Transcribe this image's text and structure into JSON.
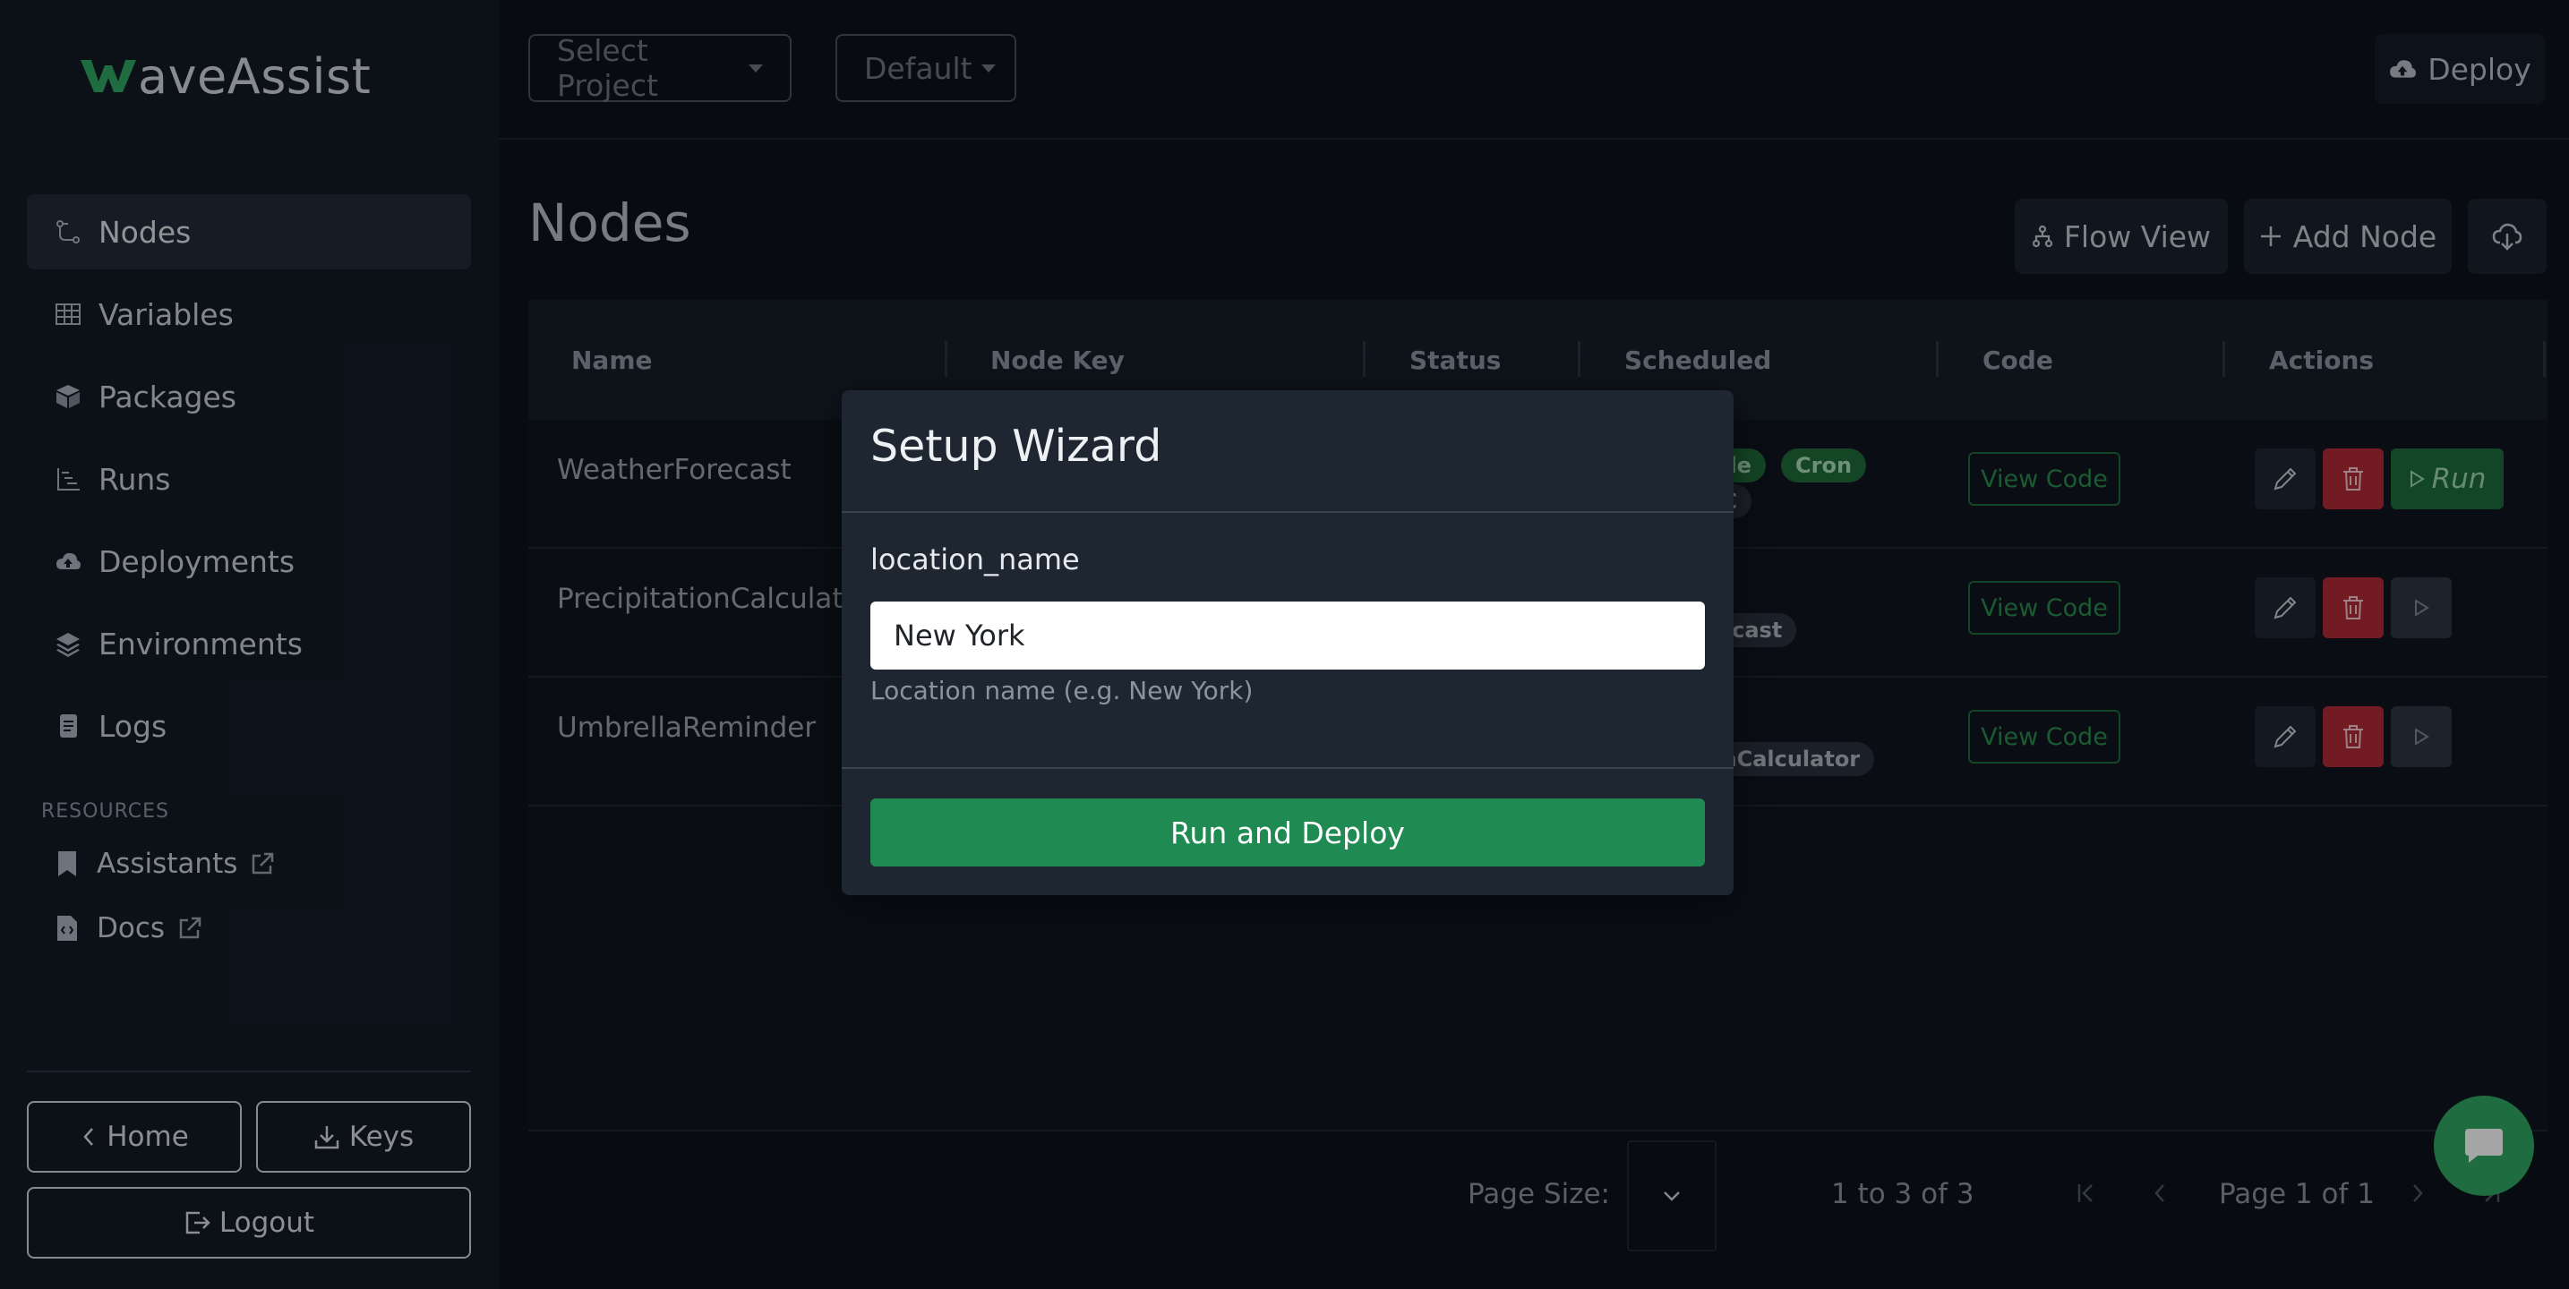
{
  "app": {
    "logo_mark": "W",
    "logo_text": "aveAssist"
  },
  "sidebar": {
    "items": [
      {
        "label": "Nodes",
        "icon": "nodes-icon"
      },
      {
        "label": "Variables",
        "icon": "table-icon"
      },
      {
        "label": "Packages",
        "icon": "package-icon"
      },
      {
        "label": "Runs",
        "icon": "runs-icon"
      },
      {
        "label": "Deployments",
        "icon": "cloud-upload-icon"
      },
      {
        "label": "Environments",
        "icon": "layers-icon"
      },
      {
        "label": "Logs",
        "icon": "file-text-icon"
      }
    ],
    "resources_title": "RESOURCES",
    "resources": [
      {
        "label": "Assistants",
        "icon": "bookmark-icon"
      },
      {
        "label": "Docs",
        "icon": "file-code-icon"
      }
    ],
    "home_label": "Home",
    "keys_label": "Keys",
    "logout_label": "Logout"
  },
  "topbar": {
    "project_select": "Select Project",
    "env_select": "Default",
    "deploy_label": "Deploy"
  },
  "main": {
    "title": "Nodes",
    "flow_view_label": "Flow View",
    "add_node_label": "Add Node",
    "columns": [
      "Name",
      "Node Key",
      "Status",
      "Scheduled",
      "Code",
      "Actions"
    ],
    "rows": [
      {
        "name": "WeatherForecast",
        "badges_top": [
          "ode",
          "Cron"
        ],
        "badges_bottom": [
          "TC"
        ],
        "view_code": "View Code",
        "run_label": "Run"
      },
      {
        "name": "PrecipitationCalculato",
        "badges_top": [
          ""
        ],
        "badges_bottom": [
          "recast"
        ],
        "view_code": "View Code"
      },
      {
        "name": "UmbrellaReminder",
        "badges_top": [
          ""
        ],
        "badges_bottom": [
          "onCalculator"
        ],
        "view_code": "View Code"
      }
    ]
  },
  "pagination": {
    "page_size_label": "Page Size:",
    "range_label": "1 to 3 of 3",
    "page_label": "Page 1 of 1"
  },
  "modal": {
    "title": "Setup Wizard",
    "field_label": "location_name",
    "field_value": "New York",
    "field_help": "Location name (e.g. New York)",
    "submit_label": "Run and Deploy"
  },
  "colors": {
    "accent_green": "#1f8a51",
    "danger_red": "#b02a37",
    "logo_green": "#2ea661"
  }
}
